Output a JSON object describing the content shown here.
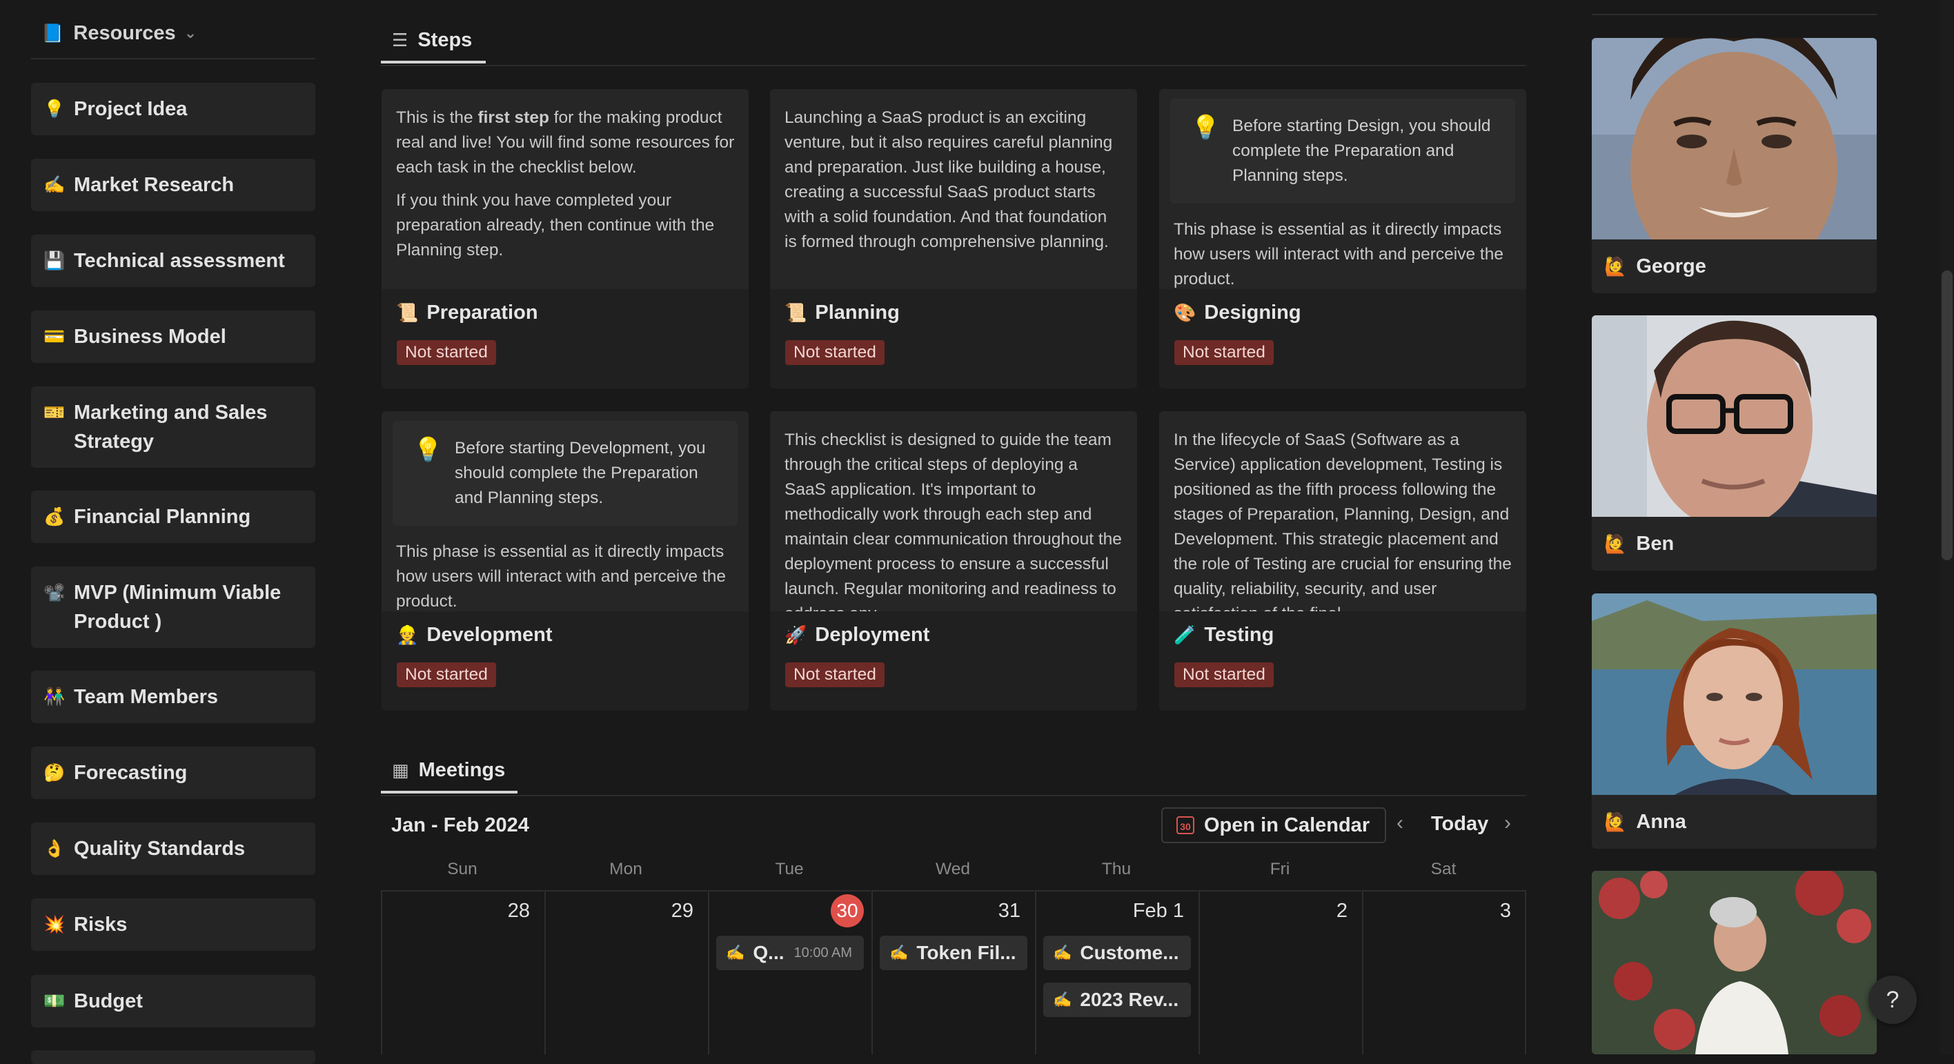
{
  "sidebar": {
    "header": {
      "label": "Resources",
      "icon": "book-icon"
    },
    "items": [
      {
        "label": "Project Idea",
        "icon": "💡"
      },
      {
        "label": "Market Research",
        "icon": "✍️"
      },
      {
        "label": "Technical assessment",
        "icon": "💾"
      },
      {
        "label": "Business Model",
        "icon": "💳"
      },
      {
        "label": "Marketing and Sales Strategy",
        "icon": "🎫"
      },
      {
        "label": "Financial Planning",
        "icon": "💰"
      },
      {
        "label": "MVP (Minimum Viable Product )",
        "icon": "📽️"
      },
      {
        "label": "Team Members",
        "icon": "👫"
      },
      {
        "label": "Forecasting",
        "icon": "🤔"
      },
      {
        "label": "Quality Standards",
        "icon": "👌"
      },
      {
        "label": "Risks",
        "icon": "💥"
      },
      {
        "label": "Budget",
        "icon": "💵"
      }
    ]
  },
  "steps": {
    "tab_label": "Steps",
    "cards": [
      {
        "text1_a": "This is the ",
        "text1_bold": "first step",
        "text1_b": " for the making product real and live! You will find some resources for each task in the checklist below.",
        "text2": "If you think you have completed your preparation already, then continue with the Planning step.",
        "title": "Preparation",
        "icon": "📜",
        "status": "Not started"
      },
      {
        "text1": "Launching a SaaS product is an exciting venture, but it also requires careful planning and preparation. Just like building a house, creating a successful SaaS product starts with a solid foundation. And that foundation is formed through comprehensive planning.",
        "title": "Planning",
        "icon": "📜",
        "status": "Not started"
      },
      {
        "callout": "Before starting Design, you should complete the Preparation and Planning steps.",
        "text1": "This phase is essential as it directly impacts how users will interact with and perceive the product.",
        "title": "Designing",
        "icon": "🎨",
        "status": "Not started"
      },
      {
        "callout": "Before starting Development, you should complete the Preparation and Planning steps.",
        "text1": "This phase is essential as it directly impacts how users will interact with and perceive the product.",
        "title": "Development",
        "icon": "👷",
        "status": "Not started"
      },
      {
        "text1": "This checklist is designed to guide the team through the critical steps of deploying a SaaS application. It's important to methodically work through each step and maintain clear communication throughout the deployment process to ensure a successful launch. Regular monitoring and readiness to address any",
        "title": "Deployment",
        "icon": "🚀",
        "status": "Not started"
      },
      {
        "text1": "In the lifecycle of SaaS (Software as a Service) application development, Testing is positioned as the fifth process following the stages of Preparation, Planning, Design, and Development. This strategic placement and the role of Testing are crucial for ensuring the quality, reliability, security, and user satisfaction of the final",
        "title": "Testing",
        "icon": "🧪",
        "status": "Not started"
      }
    ]
  },
  "meetings": {
    "tab_label": "Meetings",
    "range_label": "Jan - Feb 2024",
    "open_calendar_label": "Open in Calendar",
    "calendar_icon_day": "30",
    "today_label": "Today",
    "weekdays": [
      "Sun",
      "Mon",
      "Tue",
      "Wed",
      "Thu",
      "Fri",
      "Sat"
    ],
    "days": [
      "28",
      "29",
      "30",
      "31",
      "Feb 1",
      "2",
      "3"
    ],
    "events": [
      {
        "title": "Q...",
        "time": "10:00 AM"
      },
      {
        "title": "Token Fil..."
      },
      {
        "title": "Custome..."
      },
      {
        "title": "2023 Rev..."
      }
    ]
  },
  "team": [
    {
      "name": "George",
      "icon": "🙋"
    },
    {
      "name": "Ben",
      "icon": "🙋"
    },
    {
      "name": "Anna",
      "icon": "🙋"
    }
  ],
  "help_label": "?"
}
